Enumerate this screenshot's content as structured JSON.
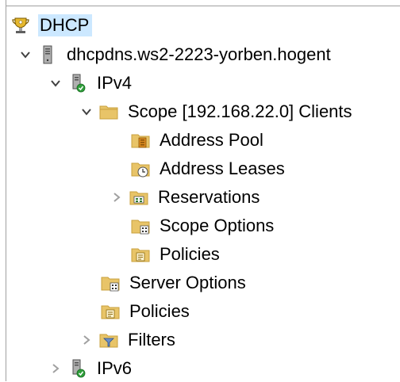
{
  "tree": {
    "root": {
      "label": "DHCP"
    },
    "server": {
      "label": "dhcpdns.ws2-2223-yorben.hogent"
    },
    "ipv4": {
      "label": "IPv4"
    },
    "scope": {
      "label": "Scope [192.168.22.0] Clients"
    },
    "address_pool": {
      "label": "Address Pool"
    },
    "address_leases": {
      "label": "Address Leases"
    },
    "reservations": {
      "label": "Reservations"
    },
    "scope_options": {
      "label": "Scope Options"
    },
    "scope_policies": {
      "label": "Policies"
    },
    "server_options": {
      "label": "Server Options"
    },
    "ipv4_policies": {
      "label": "Policies"
    },
    "filters": {
      "label": "Filters"
    },
    "ipv6": {
      "label": "IPv6"
    }
  },
  "colors": {
    "selection": "#cce8ff",
    "folder": "#e8c468",
    "folder_dark": "#c9a03c",
    "status_green": "#2e9e3a"
  },
  "icons": {
    "root": "dhcp-trophy-icon",
    "server": "server-tower-icon",
    "ipv4": "protocol-server-icon",
    "folder": "folder-icon"
  }
}
